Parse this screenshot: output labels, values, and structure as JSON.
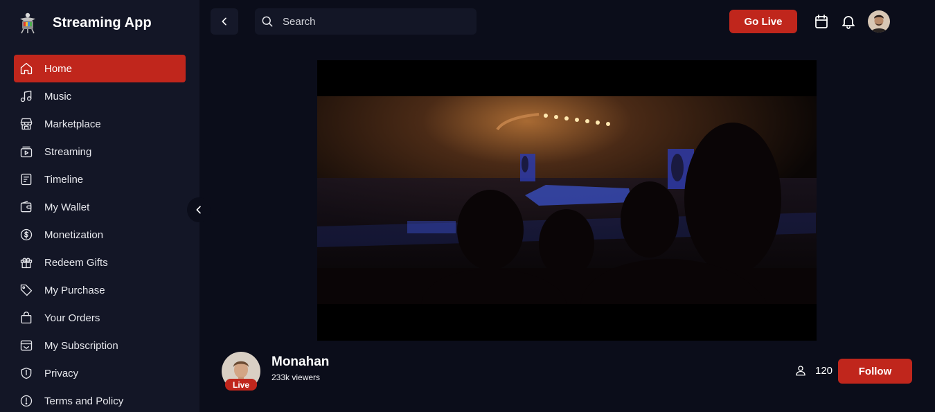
{
  "app": {
    "name": "Streaming App"
  },
  "sidebar": {
    "items": [
      {
        "label": "Home",
        "icon": "home-icon",
        "active": true
      },
      {
        "label": "Music",
        "icon": "music-icon"
      },
      {
        "label": "Marketplace",
        "icon": "store-icon"
      },
      {
        "label": "Streaming",
        "icon": "streaming-icon"
      },
      {
        "label": "Timeline",
        "icon": "timeline-icon"
      },
      {
        "label": "My Wallet",
        "icon": "wallet-icon"
      },
      {
        "label": "Monetization",
        "icon": "dollar-icon"
      },
      {
        "label": "Redeem Gifts",
        "icon": "gift-icon"
      },
      {
        "label": "My Purchase",
        "icon": "tag-icon"
      },
      {
        "label": "Your Orders",
        "icon": "bag-icon"
      },
      {
        "label": "My Subscription",
        "icon": "subscription-icon"
      },
      {
        "label": "Privacy",
        "icon": "shield-icon"
      },
      {
        "label": "Terms and Policy",
        "icon": "info-icon"
      }
    ]
  },
  "header": {
    "search_placeholder": "Search",
    "golive_label": "Go Live"
  },
  "stream": {
    "streamer_name": "Monahan",
    "viewers_text": "233k viewers",
    "live_label": "Live",
    "follower_count": "120",
    "follow_label": "Follow"
  },
  "colors": {
    "accent": "#c0261c",
    "background": "#0b0d1a",
    "sidebar": "#131626"
  }
}
